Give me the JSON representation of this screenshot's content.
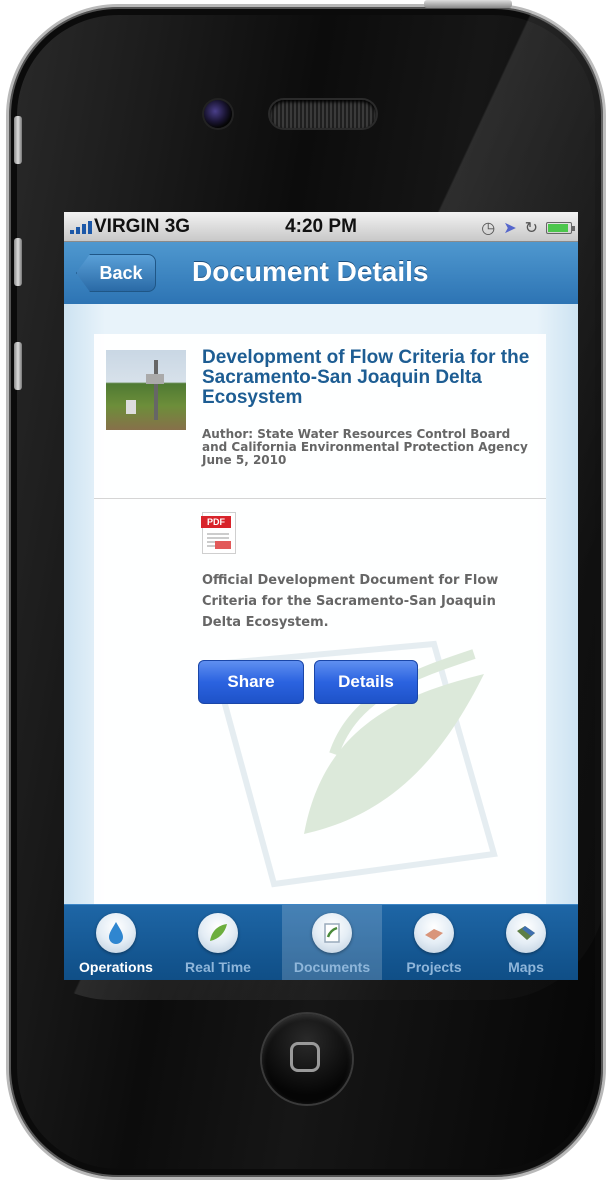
{
  "status_bar": {
    "carrier": "VIRGIN 3G",
    "time": "4:20 PM"
  },
  "nav": {
    "back_label": "Back",
    "title": "Document Details"
  },
  "document": {
    "title": "Development of Flow Criteria for the Sacramento-San Joaquin Delta Ecosystem",
    "author": "Author: State Water Resources Control Board and California Environmental Protection Agency",
    "date": "June 5, 2010",
    "file_type": "PDF",
    "description": "Official Development Document for Flow Criteria for the Sacramento-San Joaquin Delta Ecosystem."
  },
  "actions": {
    "share_label": "Share",
    "details_label": "Details"
  },
  "tabs": [
    {
      "label": "Operations",
      "icon": "water-drop-icon",
      "state": "active"
    },
    {
      "label": "Real Time",
      "icon": "leaf-icon",
      "state": "inactive"
    },
    {
      "label": "Documents",
      "icon": "document-icon",
      "state": "selected-dim"
    },
    {
      "label": "Projects",
      "icon": "projects-icon",
      "state": "inactive"
    },
    {
      "label": "Maps",
      "icon": "map-icon",
      "state": "inactive"
    }
  ],
  "colors": {
    "nav_blue": "#2d74b4",
    "button_blue": "#2b63e0",
    "title_blue": "#1d5d93",
    "tabbar_blue": "#0f4e86"
  }
}
